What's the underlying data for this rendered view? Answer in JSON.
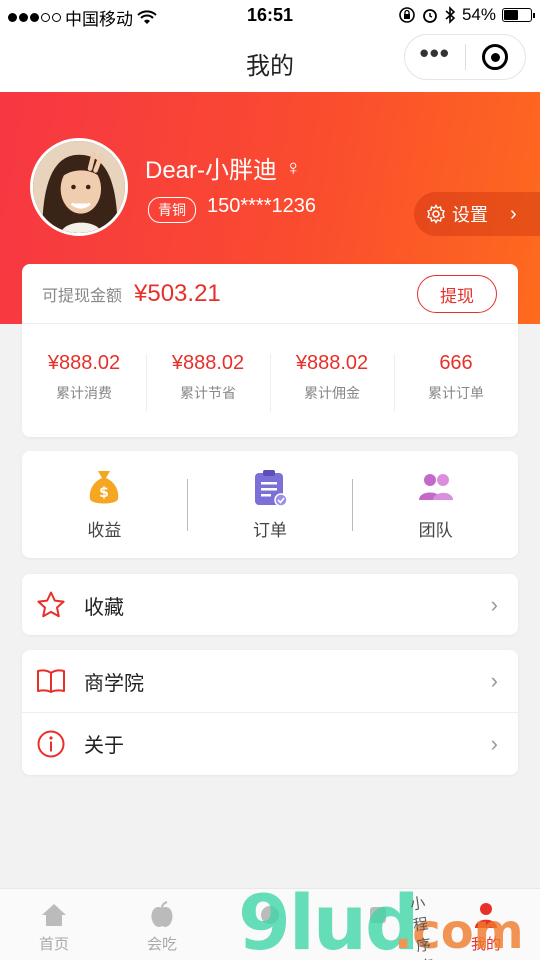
{
  "status_bar": {
    "carrier": "中国移动",
    "time": "16:51",
    "battery": "54%",
    "battery_level": 0.54
  },
  "nav": {
    "title": "我的",
    "more_label": "•••"
  },
  "profile": {
    "name": "Dear-小胖迪",
    "gender_symbol": "♀",
    "level": "青铜",
    "phone": "150****1236",
    "settings_label": "设置"
  },
  "wallet": {
    "label": "可提现金额",
    "amount": "¥503.21",
    "withdraw_label": "提现",
    "stats": [
      {
        "value": "¥888.02",
        "label": "累计消费"
      },
      {
        "value": "¥888.02",
        "label": "累计节省"
      },
      {
        "value": "¥888.02",
        "label": "累计佣金"
      },
      {
        "value": "666",
        "label": "累计订单"
      }
    ]
  },
  "entries": [
    {
      "label": "收益",
      "icon": "money-bag-icon",
      "color": "#f5a623"
    },
    {
      "label": "订单",
      "icon": "clipboard-icon",
      "color": "#7b6fd8"
    },
    {
      "label": "团队",
      "icon": "people-icon",
      "color": "#c469c9"
    }
  ],
  "menu": {
    "favorites": "收藏",
    "academy": "商学院",
    "about": "关于"
  },
  "tabs": [
    {
      "label": "首页",
      "icon": "home-icon"
    },
    {
      "label": "会吃",
      "icon": "fruit-icon"
    },
    {
      "label": "",
      "icon": "tab3-icon"
    },
    {
      "label": "",
      "icon": "tab4-icon"
    },
    {
      "label": "我的",
      "icon": "user-icon"
    }
  ],
  "watermark": {
    "text": "9lud",
    "suffix": ".com",
    "handwriting": "小程序商店"
  },
  "colors": {
    "accent": "#e7302a",
    "banner_start": "#f73743",
    "banner_end": "#fe6a1e"
  }
}
